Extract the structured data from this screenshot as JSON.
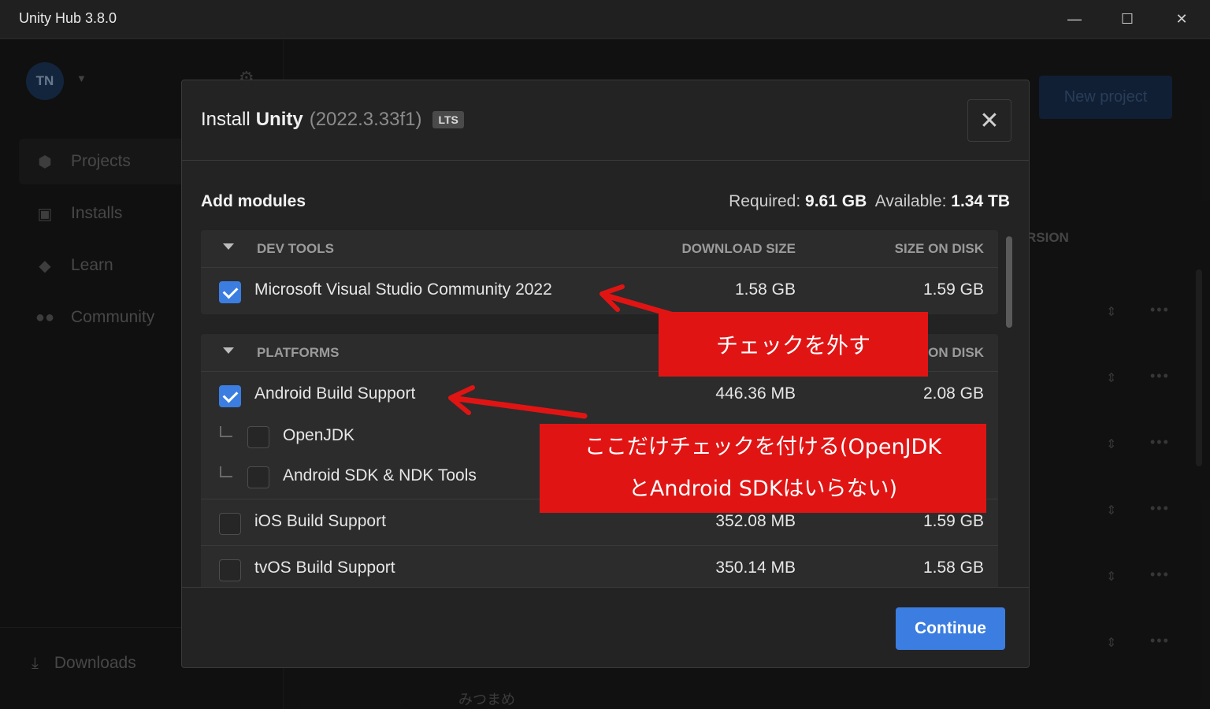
{
  "window": {
    "title": "Unity Hub 3.8.0",
    "controls": {
      "minimize": "—",
      "maximize": "☐",
      "close": "✕"
    }
  },
  "sidebar": {
    "avatar_initials": "TN",
    "items": [
      {
        "label": "Projects",
        "icon": "cube-icon",
        "active": true
      },
      {
        "label": "Installs",
        "icon": "lock-icon",
        "active": false
      },
      {
        "label": "Learn",
        "icon": "graduation-cap-icon",
        "active": false
      },
      {
        "label": "Community",
        "icon": "people-icon",
        "active": false
      }
    ],
    "downloads_label": "Downloads"
  },
  "background": {
    "new_project_label": "New project",
    "version_col_partial": "RSION",
    "bottom_project_name": "みつまめ"
  },
  "modal": {
    "title_prefix": "Install",
    "title_product": "Unity",
    "title_version": "(2022.3.33f1)",
    "badge": "LTS",
    "close_label": "✕",
    "add_modules": "Add modules",
    "required_label": "Required:",
    "required_value": "9.61 GB",
    "available_label": "Available:",
    "available_value": "1.34 TB",
    "sections": [
      {
        "name": "DEV TOOLS",
        "download_size_header": "DOWNLOAD SIZE",
        "size_on_disk_header": "SIZE ON DISK",
        "rows": [
          {
            "label": "Microsoft Visual Studio Community 2022",
            "download": "1.58 GB",
            "disk": "1.59 GB",
            "checked": true
          }
        ]
      },
      {
        "name": "PLATFORMS",
        "size_on_disk_header_partial": "ON DISK",
        "rows": [
          {
            "label": "Android Build Support",
            "download": "446.36 MB",
            "disk": "2.08 GB",
            "checked": true
          },
          {
            "label": "OpenJDK",
            "checked": false,
            "sub": true
          },
          {
            "label": "Android SDK & NDK Tools",
            "checked": false,
            "sub": true
          },
          {
            "label": "iOS Build Support",
            "download": "352.08 MB",
            "disk": "1.59 GB",
            "checked": false
          },
          {
            "label": "tvOS Build Support",
            "download": "350.14 MB",
            "disk": "1.58 GB",
            "checked": false
          }
        ]
      }
    ],
    "continue_label": "Continue"
  },
  "annotations": {
    "callout1": "チェックを外す",
    "callout2_line1": "ここだけチェックを付ける(OpenJDK",
    "callout2_line2": "とAndroid SDKはいらない)",
    "color": "#e11414"
  }
}
